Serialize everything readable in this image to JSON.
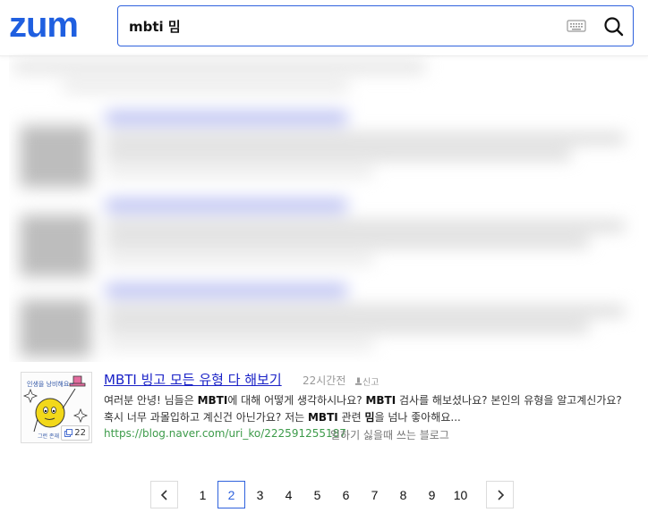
{
  "header": {
    "logo": "zum",
    "search_value": "mbti 밈",
    "keyboard_icon": "keyboard-icon",
    "search_icon": "search-icon",
    "accent_color": "#1f5fe0"
  },
  "result": {
    "title": "MBTI 빙고 모든 유형 다 해보기",
    "time": "22시간전",
    "report": "신고",
    "snippet_parts": [
      {
        "t": "여러분 안녕! 님들은 ",
        "b": false
      },
      {
        "t": "MBTI",
        "b": true
      },
      {
        "t": "에 대해 어떻게 생각하시나요? ",
        "b": false
      },
      {
        "t": "MBTI",
        "b": true
      },
      {
        "t": " 검사를 해보셨나요? 본인의 유형을 알고계신가요? 혹시 너무 과몰입하고 계신건 아닌가요? 저는 ",
        "b": false
      },
      {
        "t": "MBTI",
        "b": true
      },
      {
        "t": " 관련 ",
        "b": false
      },
      {
        "t": "밈",
        "b": true
      },
      {
        "t": "을 넘나 좋아해요...",
        "b": false
      }
    ],
    "url": "https://blog.naver.com/uri_ko/222591255187",
    "source": "일하기 싫을때 쓰는 블로그",
    "thumb_caption_top": "인생을 낭비해요~",
    "thumb_caption_bottom": "그런 존재",
    "thumb_count": "22"
  },
  "pagination": {
    "pages": [
      "1",
      "2",
      "3",
      "4",
      "5",
      "6",
      "7",
      "8",
      "9",
      "10"
    ],
    "active_index": 1,
    "prev_icon": "chevron-left-icon",
    "next_icon": "chevron-right-icon"
  }
}
